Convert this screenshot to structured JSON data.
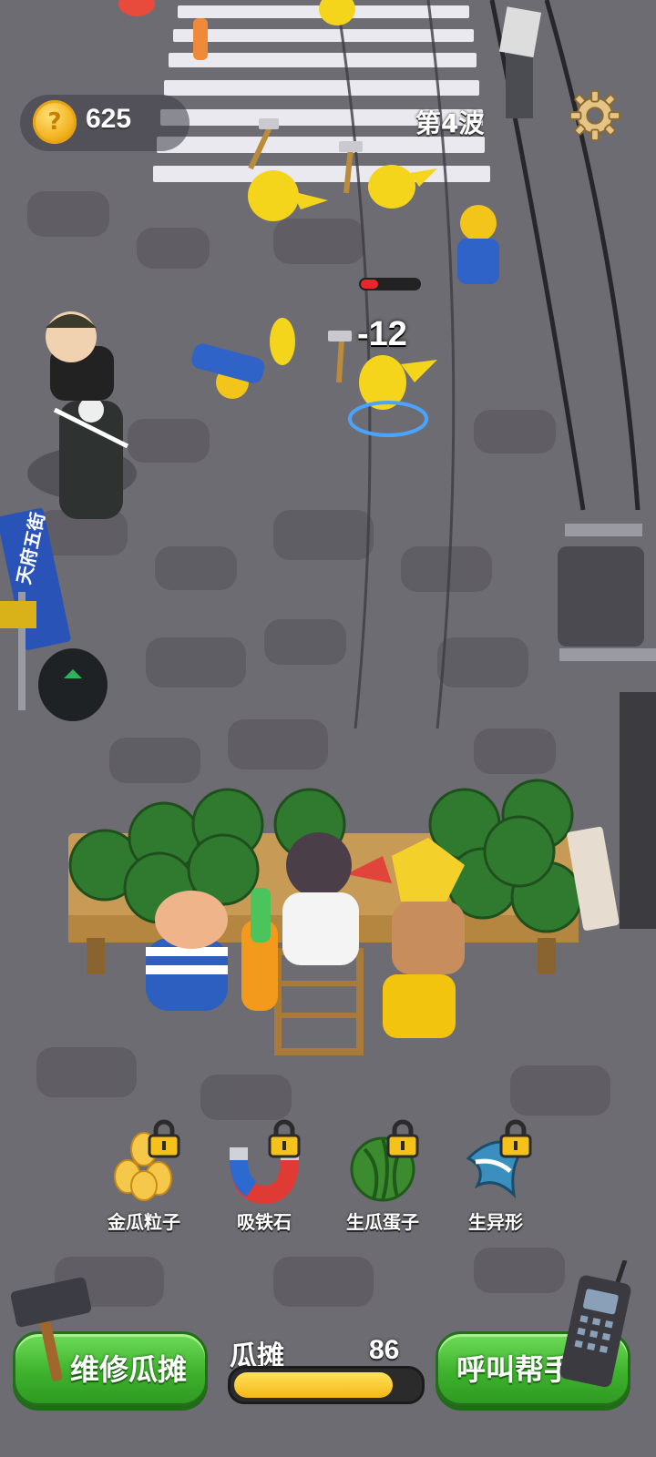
{
  "hud": {
    "coins": "625",
    "wave": "第4波"
  },
  "combat": {
    "damage_text": "-12",
    "enemy_hp_fraction": 0.3
  },
  "street_sign": "天府五街",
  "skills": [
    {
      "label": "金瓜粒子",
      "icon": "golden-seeds-icon",
      "locked": true
    },
    {
      "label": "吸铁石",
      "icon": "magnet-icon",
      "locked": true
    },
    {
      "label": "生瓜蛋子",
      "icon": "watermelon-icon",
      "locked": true
    },
    {
      "label": "生异形",
      "icon": "shark-icon",
      "locked": true
    }
  ],
  "bottom": {
    "repair_label": "维修瓜摊",
    "call_label": "呼叫帮手",
    "stall_label": "瓜摊",
    "stall_value": "86",
    "stall_fraction": 0.86
  },
  "colors": {
    "accent_green": "#3eb32d",
    "coin_gold": "#f2b21d",
    "bar_fill": "#f5b617"
  }
}
